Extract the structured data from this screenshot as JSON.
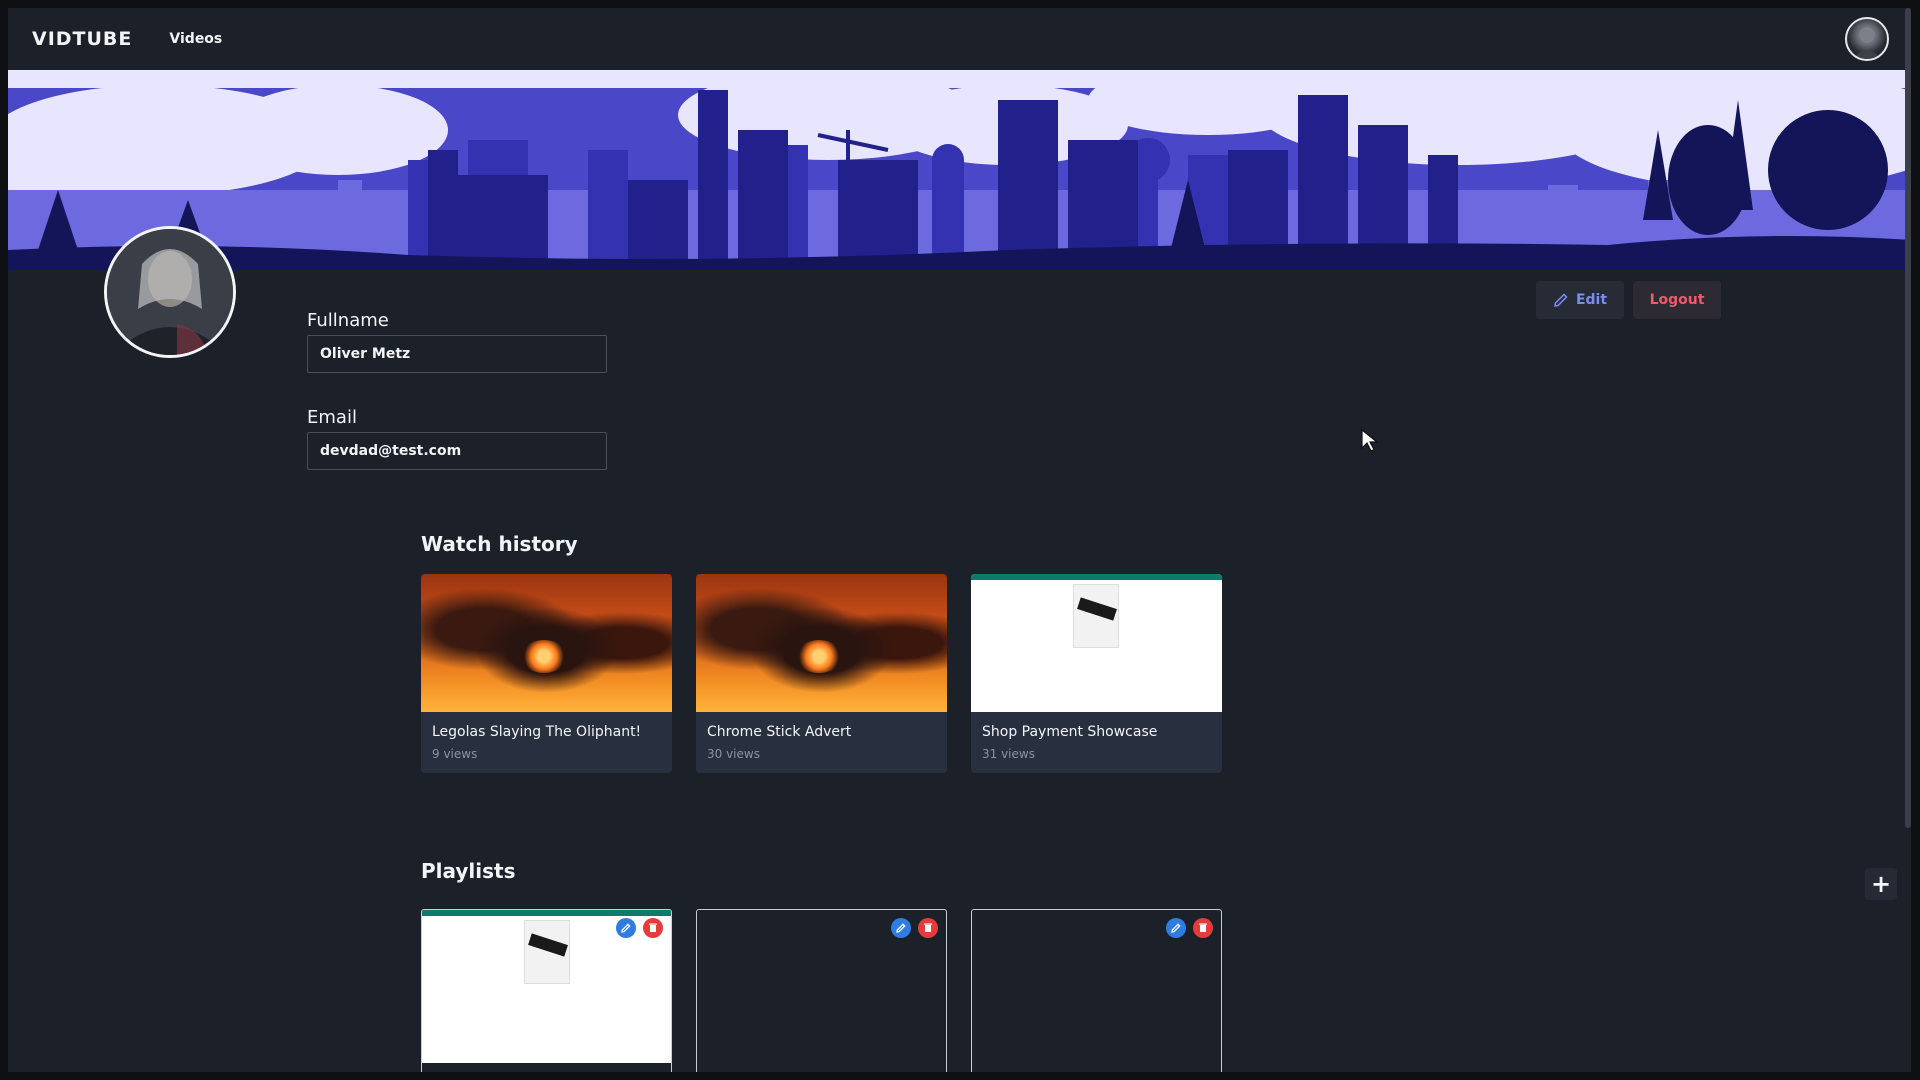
{
  "navbar": {
    "brand": "VIDTUBE",
    "links": [
      {
        "label": "Videos"
      }
    ],
    "avatar_icon": "user-avatar-icon"
  },
  "profile": {
    "fullname_label": "Fullname",
    "fullname_value": "Oliver Metz",
    "email_label": "Email",
    "email_value": "devdad@test.com",
    "edit_label": "Edit",
    "logout_label": "Logout"
  },
  "watch_history": {
    "title": "Watch history",
    "videos": [
      {
        "title": "Legolas Slaying The Oliphant!",
        "views": "9 views",
        "thumb": "dragon"
      },
      {
        "title": "Chrome Stick Advert",
        "views": "30 views",
        "thumb": "dragon"
      },
      {
        "title": "Shop Payment Showcase",
        "views": "31 views",
        "thumb": "shop"
      }
    ]
  },
  "playlists": {
    "title": "Playlists",
    "add_icon": "plus-icon",
    "items": [
      {
        "thumb": "shop"
      },
      {
        "thumb": "empty"
      },
      {
        "thumb": "empty"
      }
    ]
  },
  "colors": {
    "background": "#1c2029",
    "card": "#283040",
    "edit_accent": "#7c8cf2",
    "logout_accent": "#f05b6b",
    "banner_sky": "#e8e6ff",
    "banner_city": "#2a2a8a"
  }
}
